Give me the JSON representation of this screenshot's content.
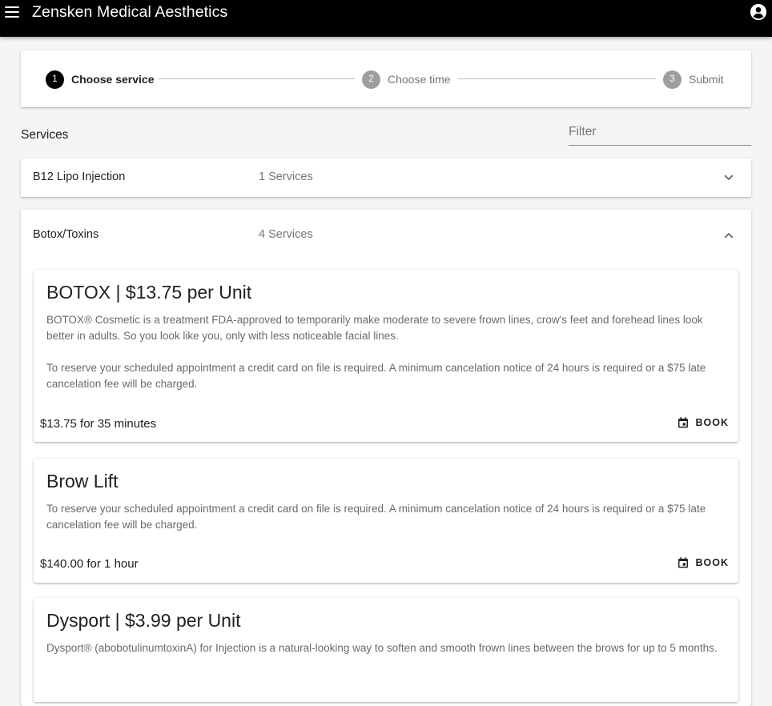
{
  "app": {
    "title": "Zensken Medical Aesthetics"
  },
  "stepper": {
    "steps": [
      {
        "number": "1",
        "label": "Choose service"
      },
      {
        "number": "2",
        "label": "Choose time"
      },
      {
        "number": "3",
        "label": "Submit"
      }
    ],
    "active_step": 1
  },
  "services": {
    "heading": "Services",
    "filter_placeholder": "Filter",
    "filter_value": ""
  },
  "categories": [
    {
      "name": "B12 Lipo Injection",
      "count": "1 Services",
      "expanded": false
    },
    {
      "name": "Botox/Toxins",
      "count": "4 Services",
      "expanded": true
    }
  ],
  "cards": [
    {
      "title": "BOTOX | $13.75 per Unit",
      "description": [
        "BOTOX® Cosmetic is a treatment FDA-approved to temporarily make moderate to severe frown lines, crow's feet and forehead lines look better in adults. So you look like you, only with less noticeable facial lines.",
        "To reserve your scheduled appointment a credit card on file is required. A minimum cancelation notice of 24 hours is required or a $75 late cancelation fee will be charged."
      ],
      "price": "$13.75 for 35 minutes",
      "book_label": "BOOK"
    },
    {
      "title": "Brow Lift",
      "description": [
        "To reserve your scheduled appointment a credit card on file is required. A minimum cancelation notice of 24 hours is required or a $75 late cancelation fee will be charged."
      ],
      "price": "$140.00 for 1 hour",
      "book_label": "BOOK"
    },
    {
      "title": "Dysport | $3.99 per Unit",
      "description": [
        "Dysport® (abobotulinumtoxinA) for Injection is a natural-looking way to soften and smooth frown lines between the brows for up to 5 months."
      ]
    }
  ],
  "icons": {
    "menu": "menu-icon",
    "account": "account-circle-icon",
    "expand": "chevron-down-icon",
    "collapse": "chevron-up-icon",
    "calendar": "calendar-icon"
  }
}
